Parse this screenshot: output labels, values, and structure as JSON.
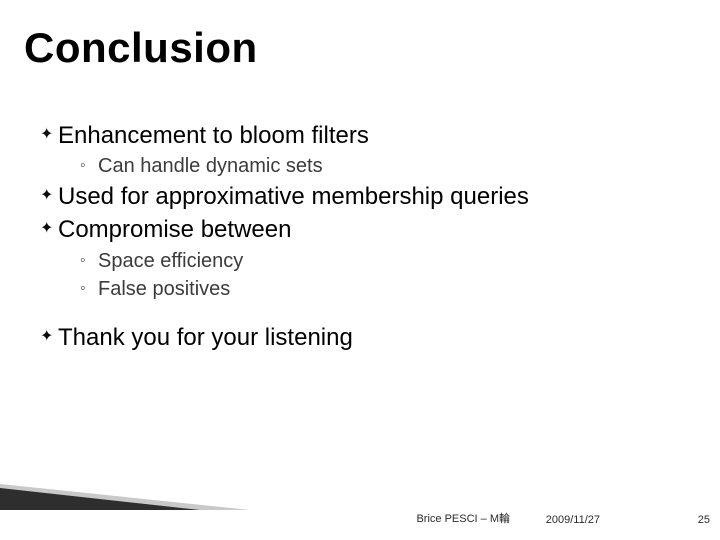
{
  "title": "Conclusion",
  "bullets": {
    "b1": "Enhancement to bloom filters",
    "b1s1": "Can handle dynamic sets",
    "b2": "Used for approximative membership queries",
    "b3": "Compromise between",
    "b3s1": "Space efficiency",
    "b3s2": "False positives",
    "b4": "Thank you for your listening"
  },
  "footer": {
    "author": "Brice PESCI – M輪",
    "date": "2009/11/27",
    "page": "25"
  }
}
